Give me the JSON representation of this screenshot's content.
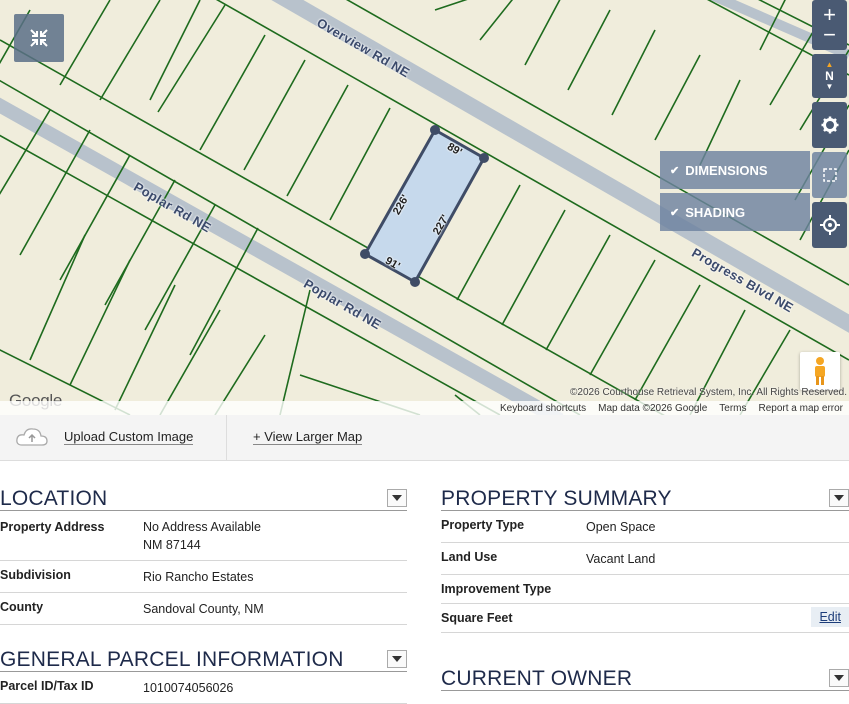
{
  "map": {
    "roads": {
      "overview": "Overview Rd NE",
      "poplar_upper": "Poplar Rd NE",
      "poplar_lower": "Poplar Rd NE",
      "progress": "Progress Blvd NE"
    },
    "dimensions": {
      "top": "89'",
      "left": "226'",
      "right": "227'",
      "bottom": "91'"
    },
    "options": {
      "dimensions": "DIMENSIONS",
      "shading": "SHADING"
    },
    "controls": {
      "zoom_in": "+",
      "zoom_out": "−",
      "north": "N"
    },
    "google_logo": "Google",
    "copyright": "©2026 Courthouse Retrieval System, Inc. All Rights Reserved.",
    "attribution": {
      "shortcuts": "Keyboard shortcuts",
      "mapdata": "Map data ©2026 Google",
      "terms": "Terms",
      "report": "Report a map error"
    },
    "colors": {
      "land": "#f0eddc",
      "parcel_line": "#1e6b1e",
      "road": "#b8c2cc",
      "selected_fill": "#c6d9ec",
      "selected_stroke": "#3f4c66"
    }
  },
  "toolbar": {
    "upload_label": "Upload Custom Image",
    "larger_map_label": "+ View Larger Map"
  },
  "location": {
    "title": "LOCATION",
    "rows": [
      {
        "label": "Property Address",
        "value_line1": "No Address Available",
        "value_line2": "NM 87144"
      },
      {
        "label": "Subdivision",
        "value": "Rio Rancho Estates"
      },
      {
        "label": "County",
        "value": "Sandoval County, NM"
      }
    ]
  },
  "summary": {
    "title": "PROPERTY SUMMARY",
    "rows": [
      {
        "label": "Property Type",
        "value": "Open Space"
      },
      {
        "label": "Land Use",
        "value": "Vacant Land"
      },
      {
        "label": "Improvement Type",
        "value": ""
      },
      {
        "label": "Square Feet",
        "value": ""
      }
    ],
    "edit_label": "Edit"
  },
  "general": {
    "title": "GENERAL PARCEL INFORMATION",
    "rows": [
      {
        "label": "Parcel ID/Tax ID",
        "value": "1010074056026"
      }
    ]
  },
  "owner": {
    "title": "CURRENT OWNER"
  }
}
